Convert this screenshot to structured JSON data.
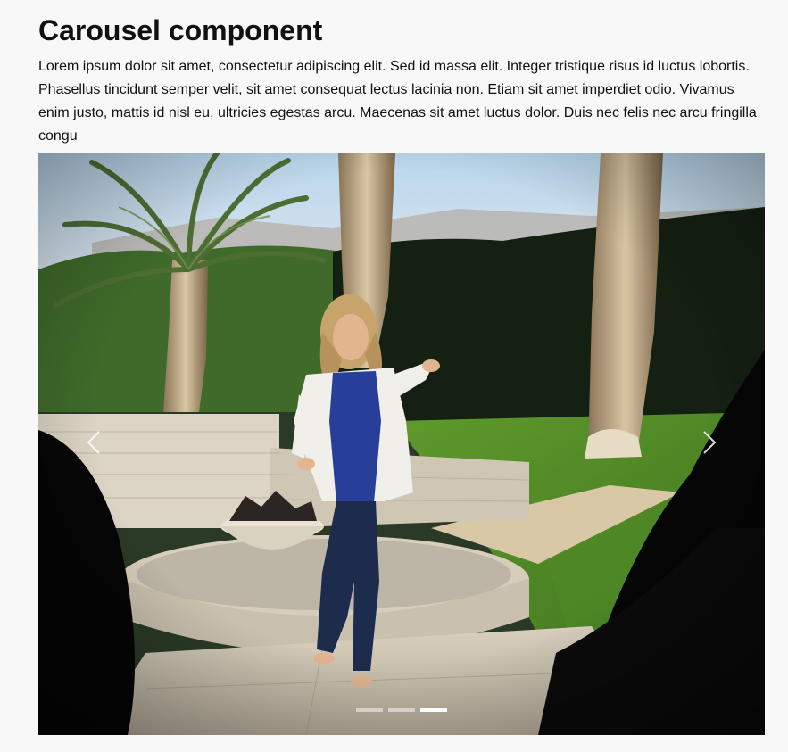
{
  "page": {
    "title": "Carousel component",
    "intro": "Lorem ipsum dolor sit amet, consectetur adipiscing elit. Sed id massa elit. Integer tristique risus id luctus lobortis. Phasellus tincidunt semper velit, sit amet consequat lectus lacinia non. Etiam sit amet imperdiet odio. Vivamus enim justo, mattis id nisl eu, ultricies egestas arcu. Maecenas sit amet luctus dolor. Duis nec felis nec arcu fringilla congu"
  },
  "carousel": {
    "prev_icon": "chevron-left-icon",
    "next_icon": "chevron-right-icon",
    "slide_count": 3,
    "active_slide": 3
  },
  "colors": {
    "page_background": "#f8f8f8",
    "indicator_active": "#ffffff",
    "indicator_inactive": "#bdbdbd"
  }
}
